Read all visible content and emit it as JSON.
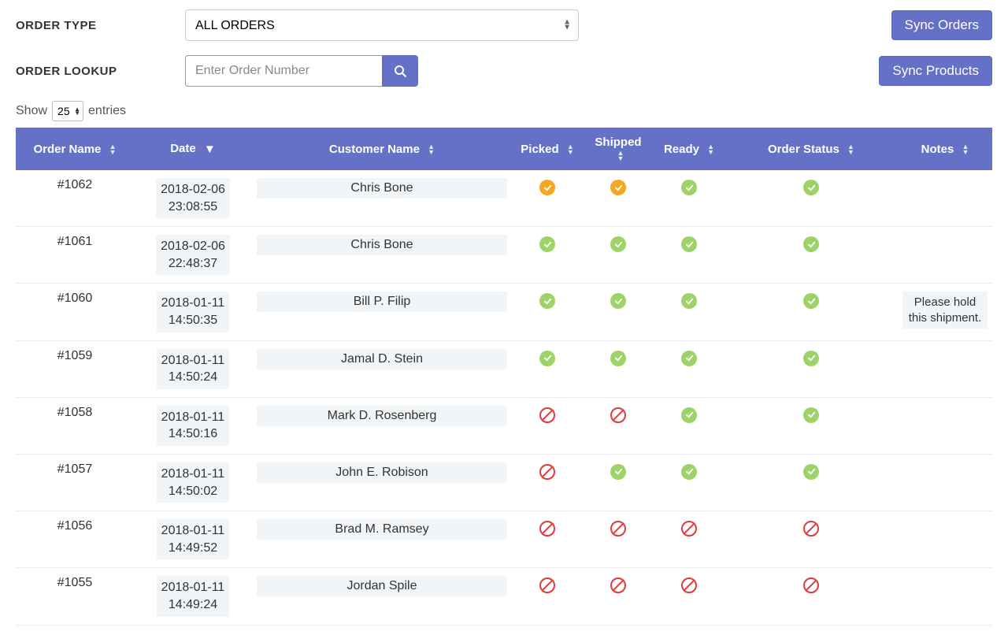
{
  "filters": {
    "order_type_label": "ORDER TYPE",
    "order_type_value": "ALL ORDERS",
    "order_lookup_label": "ORDER LOOKUP",
    "order_lookup_placeholder": "Enter Order Number"
  },
  "buttons": {
    "sync_orders": "Sync Orders",
    "sync_products": "Sync Products"
  },
  "entries": {
    "show": "Show",
    "count": "25",
    "suffix": "entries"
  },
  "columns": {
    "order": "Order Name",
    "date": "Date",
    "customer": "Customer Name",
    "picked": "Picked",
    "shipped": "Shipped",
    "ready": "Ready",
    "status": "Order Status",
    "notes": "Notes"
  },
  "rows": [
    {
      "order": "#1062",
      "date": "2018-02-06",
      "time": "23:08:55",
      "customer": "Chris Bone",
      "picked": "orange",
      "shipped": "orange",
      "ready": "green",
      "status": "green",
      "notes": ""
    },
    {
      "order": "#1061",
      "date": "2018-02-06",
      "time": "22:48:37",
      "customer": "Chris Bone",
      "picked": "green",
      "shipped": "green",
      "ready": "green",
      "status": "green",
      "notes": ""
    },
    {
      "order": "#1060",
      "date": "2018-01-11",
      "time": "14:50:35",
      "customer": "Bill P. Filip",
      "picked": "green",
      "shipped": "green",
      "ready": "green",
      "status": "green",
      "notes": "Please hold this shipment."
    },
    {
      "order": "#1059",
      "date": "2018-01-11",
      "time": "14:50:24",
      "customer": "Jamal D. Stein",
      "picked": "green",
      "shipped": "green",
      "ready": "green",
      "status": "green",
      "notes": ""
    },
    {
      "order": "#1058",
      "date": "2018-01-11",
      "time": "14:50:16",
      "customer": "Mark D. Rosenberg",
      "picked": "red",
      "shipped": "red",
      "ready": "green",
      "status": "green",
      "notes": ""
    },
    {
      "order": "#1057",
      "date": "2018-01-11",
      "time": "14:50:02",
      "customer": "John E. Robison",
      "picked": "red",
      "shipped": "green",
      "ready": "green",
      "status": "green",
      "notes": ""
    },
    {
      "order": "#1056",
      "date": "2018-01-11",
      "time": "14:49:52",
      "customer": "Brad M. Ramsey",
      "picked": "red",
      "shipped": "red",
      "ready": "red",
      "status": "red",
      "notes": ""
    },
    {
      "order": "#1055",
      "date": "2018-01-11",
      "time": "14:49:24",
      "customer": "Jordan Spile",
      "picked": "red",
      "shipped": "red",
      "ready": "red",
      "status": "red",
      "notes": ""
    }
  ]
}
